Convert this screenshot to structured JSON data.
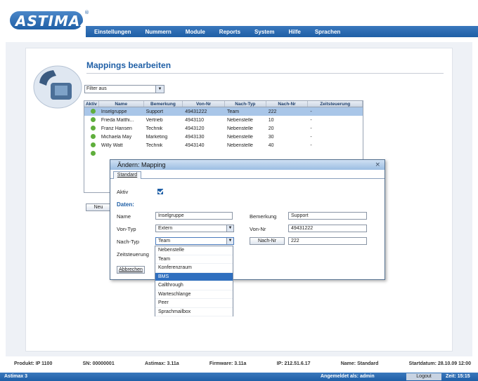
{
  "header": {
    "logo_text": "ASTIMAX",
    "logo_reg": "®",
    "nav": [
      "Einstellungen",
      "Nummern",
      "Module",
      "Reports",
      "System",
      "Hilfe",
      "Sprachen"
    ]
  },
  "page": {
    "title": "Mappings bearbeiten",
    "filter_value": "Filter aus",
    "new_button": "Neu"
  },
  "grid": {
    "columns": [
      "Aktiv",
      "Name",
      "Bemerkung",
      "Von-Nr",
      "Nach-Typ",
      "Nach-Nr",
      "Zeitsteuerung"
    ],
    "rows": [
      {
        "name": "Inselgruppe",
        "bemerkung": "Support",
        "von": "49431222",
        "typ": "Team",
        "nach": "222",
        "zeit": "-"
      },
      {
        "name": "Frieda Matthi...",
        "bemerkung": "Vertrieb",
        "von": "4943110",
        "typ": "Nebenstelle",
        "nach": "10",
        "zeit": "-"
      },
      {
        "name": "Franz Hansen",
        "bemerkung": "Technik",
        "von": "4943120",
        "typ": "Nebenstelle",
        "nach": "20",
        "zeit": "-"
      },
      {
        "name": "Michaela May",
        "bemerkung": "Marketing",
        "von": "4943130",
        "typ": "Nebenstelle",
        "nach": "30",
        "zeit": "-"
      },
      {
        "name": "Willy Watt",
        "bemerkung": "Technik",
        "von": "4943140",
        "typ": "Nebenstelle",
        "nach": "40",
        "zeit": "-"
      }
    ]
  },
  "dialog": {
    "title": "Ändern: Mapping",
    "close": "×",
    "tab": "Standard",
    "aktiv_label": "Aktiv",
    "section": "Daten:",
    "name_label": "Name",
    "name_value": "Inselgruppe",
    "bemerkung_label": "Bemerkung",
    "bemerkung_value": "Support",
    "vontyp_label": "Von-Typ",
    "vontyp_value": "Extern",
    "vonnr_label": "Von-Nr",
    "vonnr_value": "49431222",
    "nachtyp_label": "Nach-Typ",
    "nachtyp_value": "Team",
    "nachnr_button": "Nach-Nr",
    "nachnr_value": "222",
    "zeit_label": "Zeitsteuerung",
    "cancel_button": "Abbrechen"
  },
  "dropdown_options": [
    "Nebenstelle",
    "Team",
    "Konferenzraum",
    "BMS",
    "Callthrough",
    "Warteschlange",
    "Peer",
    "Sprachmailbox"
  ],
  "status": {
    "produkt": "Produkt: IP 1100",
    "sn": "SN: 00000001",
    "astimax": "Astimax: 3.11a",
    "firmware": "Firmware: 3.11a",
    "ip": "IP: 212.51.6.17",
    "name": "Name: Standard",
    "start": "Startdatum: 28.10.09 12:00"
  },
  "footer": {
    "left": "Astimax 3",
    "user": "Angemeldet als: admin",
    "logout": "Logout",
    "time": "Zeit: 15:15"
  },
  "colors": {
    "accent": "#1f5fa6",
    "selection": "#a9c6e8",
    "dropdown_selected": "#2f6fbf"
  }
}
